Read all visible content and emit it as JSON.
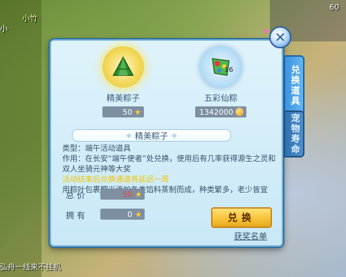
{
  "hud": {
    "top_left": "小竹",
    "top_left2": "小",
    "top_mid": "",
    "top_right_count": "60",
    "bottom_left": "弘舟一线来不挂机",
    "bottom_right": ""
  },
  "panel": {
    "close_symbol": "✕",
    "tabs": [
      {
        "label": "兑换道具",
        "active": true
      },
      {
        "label": "宠物寿命",
        "active": false
      }
    ],
    "items": [
      {
        "name": "精美粽子",
        "price": "50",
        "currency_icon": "star-icon"
      },
      {
        "name": "五彩仙粽",
        "price": "1342000",
        "count": "16",
        "currency_icon": "coin-icon"
      }
    ],
    "detail": {
      "title": "精美粽子",
      "type_line": "类型：端午活动道具",
      "use_line": "作用：在长安“端午使者”处兑换，使用后有几率获得源生之灵和双人坐骑元神等大奖",
      "highlight_line": "活动结束后兑换通道将延迟一周",
      "flavor_line": "用粽叶包裹糯米添加各类馅料蒸制而成，种类繁多，老少皆宜"
    },
    "total_label": "总 价",
    "total_value": "50",
    "owned_label": "拥 有",
    "owned_value": "0",
    "exchange_button": "兑换",
    "reward_list_link": "获奖名单"
  },
  "colors": {
    "panel_bg": "#dff3fb",
    "panel_border": "#2f6f9f",
    "button_gold": "#f7c43a",
    "tab_blue": "#3d93e0",
    "price_red": "#ff3a3a",
    "highlight_yellow": "#f2c400"
  }
}
